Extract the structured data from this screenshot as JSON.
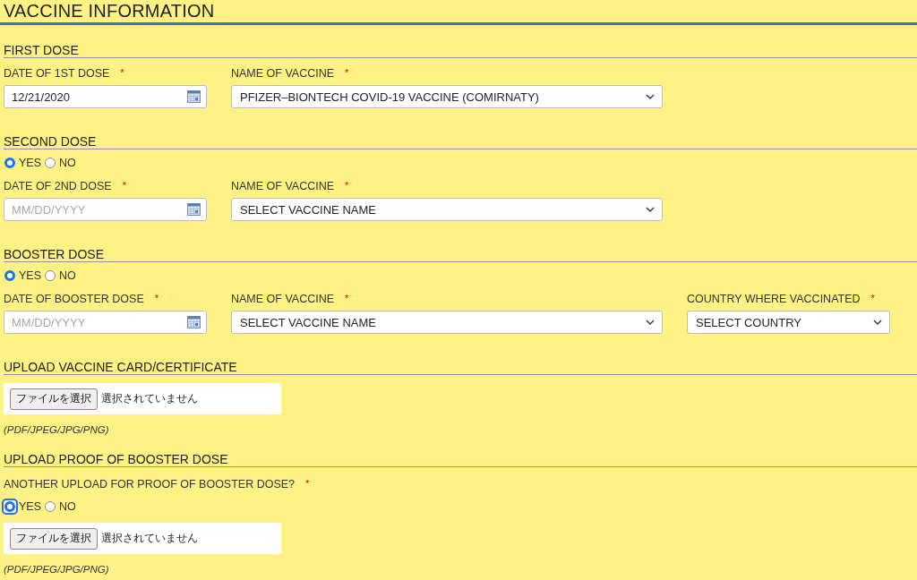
{
  "title": "VACCINE INFORMATION",
  "sections": [
    {
      "title": "FIRST DOSE",
      "rows": [
        {
          "kind": "fields",
          "fields": [
            {
              "kind": "date",
              "label": "DATE OF 1ST DOSE",
              "required_mark": "*",
              "value": "12/21/2020"
            },
            {
              "kind": "select",
              "label": "NAME OF VACCINE",
              "required_mark": "*",
              "value": "PFIZER–BIONTECH COVID-19 VACCINE (COMIRNATY)"
            }
          ]
        }
      ]
    },
    {
      "title": "SECOND DOSE",
      "rows": [
        {
          "kind": "radios",
          "options": [
            {
              "label": "YES",
              "selected": true,
              "focused": false
            },
            {
              "label": "NO",
              "selected": false,
              "focused": false
            }
          ]
        },
        {
          "kind": "fields",
          "fields": [
            {
              "kind": "date",
              "label": "DATE OF 2ND DOSE",
              "required_mark": "*",
              "placeholder": "MM/DD/YYYY"
            },
            {
              "kind": "select",
              "label": "NAME OF VACCINE",
              "required_mark": "*",
              "value": "SELECT VACCINE NAME"
            }
          ]
        }
      ]
    },
    {
      "title": "BOOSTER DOSE",
      "rows": [
        {
          "kind": "radios",
          "options": [
            {
              "label": "YES",
              "selected": true,
              "focused": false
            },
            {
              "label": "NO",
              "selected": false,
              "focused": false
            }
          ]
        },
        {
          "kind": "fields",
          "fields": [
            {
              "kind": "date",
              "label": "DATE OF BOOSTER DOSE",
              "required_mark": "*",
              "placeholder": "MM/DD/YYYY"
            },
            {
              "kind": "select",
              "label": "NAME OF VACCINE",
              "required_mark": "*",
              "value": "SELECT VACCINE NAME"
            },
            {
              "kind": "short_select",
              "label": "COUNTRY WHERE VACCINATED",
              "required_mark": "*",
              "value": "SELECT COUNTRY"
            }
          ]
        }
      ]
    },
    {
      "title": "UPLOAD VACCINE CARD/CERTIFICATE",
      "rows": [
        {
          "kind": "file",
          "button": "ファイルを選択",
          "status": "選択されていません"
        },
        {
          "kind": "hint",
          "text": "(PDF/JPEG/JPG/PNG)"
        }
      ]
    },
    {
      "title": "UPLOAD PROOF OF BOOSTER DOSE",
      "rows": [
        {
          "kind": "question",
          "label": "ANOTHER UPLOAD FOR PROOF OF BOOSTER DOSE?",
          "required_mark": "*"
        },
        {
          "kind": "radios",
          "options": [
            {
              "label": "YES",
              "selected": true,
              "focused": true
            },
            {
              "label": "NO",
              "selected": false,
              "focused": false
            }
          ]
        },
        {
          "kind": "file",
          "button": "ファイルを選択",
          "status": "選択されていません"
        },
        {
          "kind": "hint",
          "text": "(PDF/JPEG/JPG/PNG)"
        }
      ]
    }
  ]
}
